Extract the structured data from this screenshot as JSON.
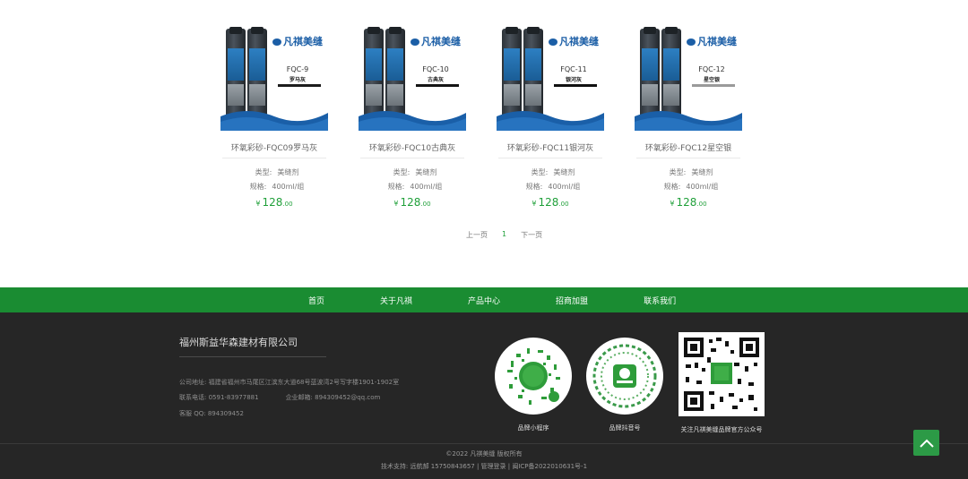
{
  "products": [
    {
      "code": "FQC-9",
      "color_name": "罗马灰",
      "swatch": "#1c1c1c",
      "title": "环氧彩砂-FQC09罗马灰",
      "type_label": "类型:",
      "type_value": "美缝剂",
      "spec_label": "规格:",
      "spec_value": "400ml/组",
      "currency": "¥",
      "price_int": "128",
      "price_dec": ".00"
    },
    {
      "code": "FQC-10",
      "color_name": "古典灰",
      "swatch": "#141414",
      "title": "环氧彩砂-FQC10古典灰",
      "type_label": "类型:",
      "type_value": "美缝剂",
      "spec_label": "规格:",
      "spec_value": "400ml/组",
      "currency": "¥",
      "price_int": "128",
      "price_dec": ".00"
    },
    {
      "code": "FQC-11",
      "color_name": "银河灰",
      "swatch": "#101010",
      "title": "环氧彩砂-FQC11银河灰",
      "type_label": "类型:",
      "type_value": "美缝剂",
      "spec_label": "规格:",
      "spec_value": "400ml/组",
      "currency": "¥",
      "price_int": "128",
      "price_dec": ".00"
    },
    {
      "code": "FQC-12",
      "color_name": "星空银",
      "swatch": "#9a9a9a",
      "title": "环氧彩砂-FQC12星空银",
      "type_label": "类型:",
      "type_value": "美缝剂",
      "spec_label": "规格:",
      "spec_value": "400ml/组",
      "currency": "¥",
      "price_int": "128",
      "price_dec": ".00"
    }
  ],
  "product_brand": "凡祺美缝",
  "pagination": {
    "prev": "上一页",
    "current": "1",
    "next": "下一页"
  },
  "nav": {
    "items": [
      "首页",
      "关于凡祺",
      "产品中心",
      "招商加盟",
      "联系我们"
    ]
  },
  "footer": {
    "company": "福州斯益华森建材有限公司",
    "address": "公司地址:  福建省福州市马尾区江滨东大道68号蓝波湾2号写字楼1901-1902室",
    "phone": "联系电话:  0591-83977881",
    "email": "企业邮箱:  894309452@qq.com",
    "qq": "客服 QQ:  894309452",
    "qr_mini_label": "品牌小程序",
    "qr_douyin_label": "品牌抖音号",
    "qr_wechat_label": "关注凡祺美缝品牌官方公众号",
    "copyright": "©2022 凡祺美缝 版权所有",
    "support": "技术支持: 远航郝 15750843657 | 管理登录 | 闽ICP备2022010631号-1"
  },
  "colors": {
    "accent_green": "#1a8c32",
    "footer_bg": "#262626",
    "price_green": "#20a03a"
  }
}
